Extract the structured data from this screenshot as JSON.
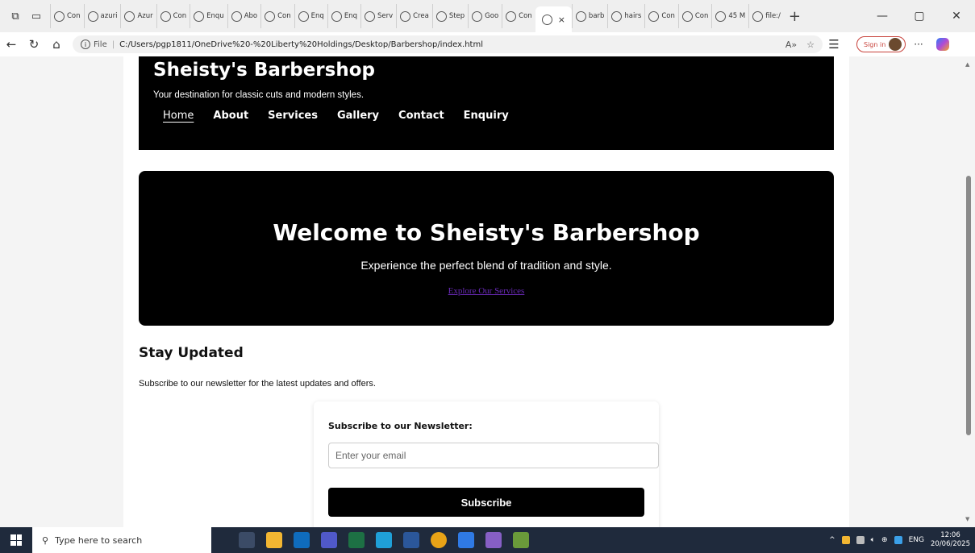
{
  "browser": {
    "tabs": [
      {
        "label": "Con"
      },
      {
        "label": "azuri"
      },
      {
        "label": "Azur"
      },
      {
        "label": "Con"
      },
      {
        "label": "Enqu"
      },
      {
        "label": "Abo"
      },
      {
        "label": "Con"
      },
      {
        "label": "Enq"
      },
      {
        "label": "Enq"
      },
      {
        "label": "Serv"
      },
      {
        "label": "Crea"
      },
      {
        "label": "Step"
      },
      {
        "label": "Goo"
      },
      {
        "label": "Con"
      }
    ],
    "active_tab_close": "×",
    "tabs_after": [
      {
        "label": "barb"
      },
      {
        "label": "hairs"
      },
      {
        "label": "Con"
      },
      {
        "label": "Con"
      },
      {
        "label": "45 M"
      },
      {
        "label": "file:/"
      }
    ],
    "new_tab": "+",
    "address": {
      "label": "File",
      "separator": "|",
      "url": "C:/Users/pgp1811/OneDrive%20-%20Liberty%20Holdings/Desktop/Barbershop/index.html"
    },
    "sign_in_label": "Sign in",
    "window_controls": {
      "minimize": "—",
      "restore": "▢",
      "close": "✕"
    }
  },
  "site": {
    "title": "Sheisty's Barbershop",
    "tagline": "Your destination for classic cuts and modern styles.",
    "nav": [
      "Home",
      "About",
      "Services",
      "Gallery",
      "Contact",
      "Enquiry"
    ],
    "hero": {
      "heading": "Welcome to Sheisty's Barbershop",
      "subtext": "Experience the perfect blend of tradition and style.",
      "link": "Explore Our Services"
    },
    "updates": {
      "heading": "Stay Updated",
      "text": "Subscribe to our newsletter for the latest updates and offers."
    },
    "newsletter": {
      "label": "Subscribe to our Newsletter:",
      "placeholder": "Enter your email",
      "button": "Subscribe"
    }
  },
  "taskbar": {
    "search_placeholder": "Type here to search",
    "language": "ENG",
    "time": "12:06",
    "date": "20/06/2025"
  },
  "colors": {
    "page_accent": "#000000",
    "link": "#6a2ab8",
    "taskbar": "#1f2a3c"
  }
}
